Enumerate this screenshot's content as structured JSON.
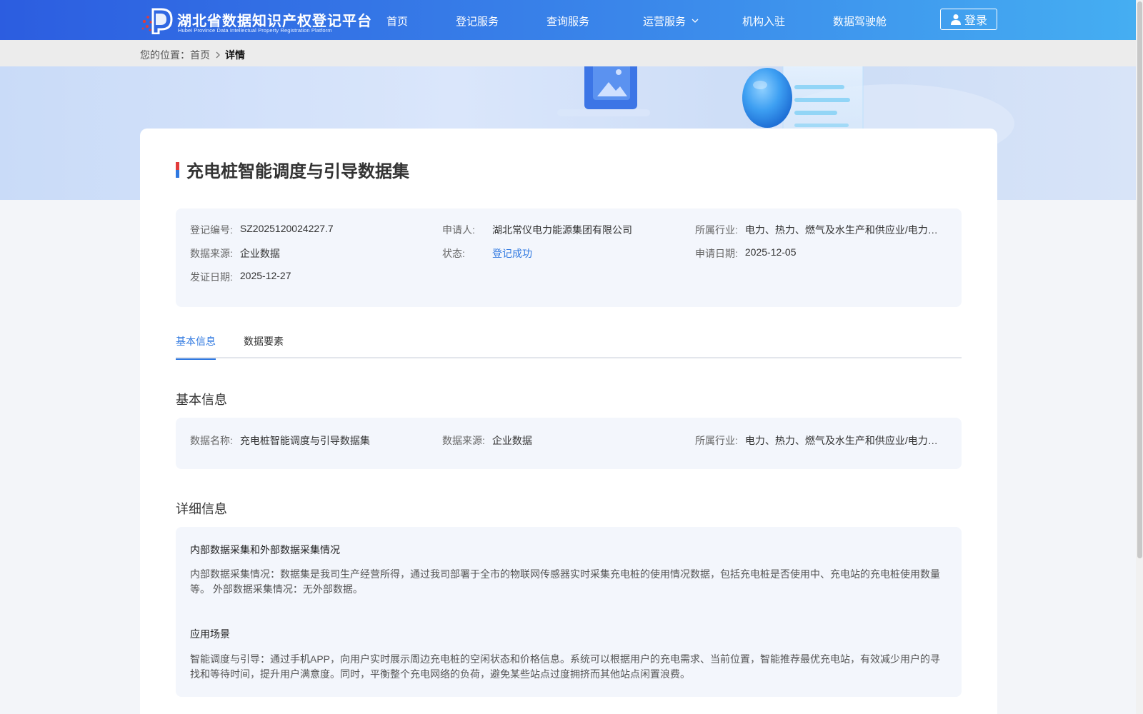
{
  "header": {
    "logo_cn": "湖北省数据知识产权登记平台",
    "logo_en": "Hubei Province Data Intellectual Property Registration Platform",
    "nav": [
      {
        "label": "首页"
      },
      {
        "label": "登记服务"
      },
      {
        "label": "查询服务"
      },
      {
        "label": "运营服务"
      },
      {
        "label": "机构入驻"
      },
      {
        "label": "数据驾驶舱"
      }
    ],
    "login_label": "登录"
  },
  "breadcrumb": {
    "prefix": "您的位置：",
    "home": "首页",
    "current": "详情"
  },
  "title": "充电桩智能调度与引导数据集",
  "summary": {
    "reg_no": {
      "label": "登记编号:",
      "value": "SZ2025120024227.7"
    },
    "applicant": {
      "label": "申请人:",
      "value": "湖北常仪电力能源集团有限公司"
    },
    "industry": {
      "label": "所属行业:",
      "value": "电力、热力、燃气及水生产和供应业/电力、热力生产和供应业"
    },
    "source": {
      "label": "数据来源:",
      "value": "企业数据"
    },
    "status": {
      "label": "状态:",
      "value": "登记成功"
    },
    "apply_date": {
      "label": "申请日期:",
      "value": "2025-12-05"
    },
    "issue_date": {
      "label": "发证日期:",
      "value": "2025-12-27"
    }
  },
  "tabs": [
    {
      "label": "基本信息",
      "active": true
    },
    {
      "label": "数据要素",
      "active": false
    }
  ],
  "basic": {
    "title": "基本信息",
    "name": {
      "label": "数据名称:",
      "value": "充电桩智能调度与引导数据集"
    },
    "source": {
      "label": "数据来源:",
      "value": "企业数据"
    },
    "industry": {
      "label": "所属行业:",
      "value": "电力、热力、燃气及水生产和供应业/电力、热力生产和供应业"
    }
  },
  "detail": {
    "title": "详细信息",
    "sections": [
      {
        "heading": "内部数据采集和外部数据采集情况",
        "body": "内部数据采集情况：数据集是我司生产经营所得，通过我司部署于全市的物联网传感器实时采集充电桩的使用情况数据，包括充电桩是否使用中、充电站的充电桩使用数量等。 外部数据采集情况：无外部数据。"
      },
      {
        "heading": "应用场景",
        "body": "智能调度与引导：通过手机APP，向用户实时展示周边充电桩的空闲状态和价格信息。系统可以根据用户的充电需求、当前位置，智能推荐最优充电站，有效减少用户的寻找和等待时间，提升用户满意度。同时，平衡整个充电网络的负荷，避免某些站点过度拥挤而其他站点闲置浪费。"
      }
    ]
  },
  "colors": {
    "accent": "#2f78e0",
    "header_start": "#2c5de0",
    "header_end": "#45aef2",
    "panel_bg": "#f3f6fc"
  },
  "icons": {
    "logo": "logo-mark-icon",
    "login": "user-icon",
    "breadcrumb_sep": "chevron-right-icon",
    "nav_dropdown": "chevron-down-icon"
  }
}
